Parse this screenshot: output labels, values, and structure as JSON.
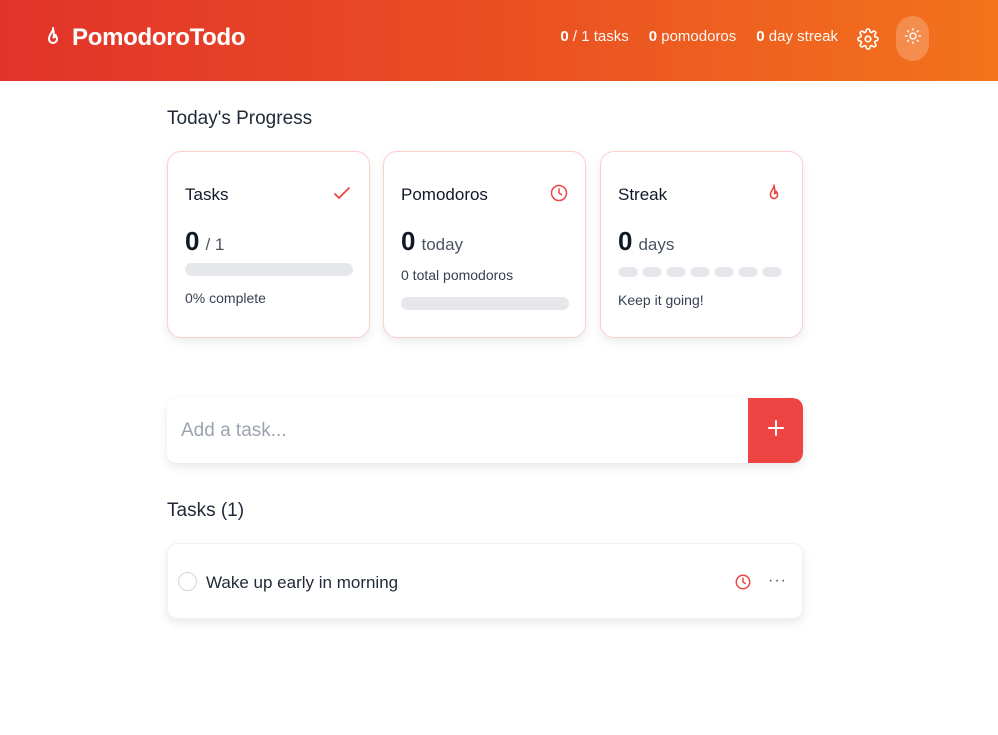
{
  "app": {
    "name": "PomodoroTodo"
  },
  "header": {
    "stats": {
      "tasks_done": "0",
      "tasks_total": "/ 1 tasks",
      "pomodoros_count": "0",
      "pomodoros_label": "pomodoros",
      "streak_count": "0",
      "streak_label": "day streak"
    },
    "settings_icon": "gear-icon",
    "theme_icon": "sun-icon"
  },
  "progress": {
    "title": "Today's Progress",
    "tasks_card": {
      "title": "Tasks",
      "icon": "check-icon",
      "value": "0",
      "value_suffix": "/ 1",
      "progress_fraction": 0,
      "note": "0% complete"
    },
    "pomodoros_card": {
      "title": "Pomodoros",
      "icon": "clock-icon",
      "value": "0",
      "value_suffix": "today",
      "note": "0 total pomodoros",
      "progress_fraction": 0
    },
    "streak_card": {
      "title": "Streak",
      "icon": "flame-icon",
      "value": "0",
      "value_suffix": "days",
      "streak_days_filled": 0,
      "streak_days_total": 7,
      "note": "Keep it going!"
    }
  },
  "add_task": {
    "placeholder": "Add a task...",
    "button_icon": "plus-icon"
  },
  "tasks": {
    "title": "Tasks (1)",
    "items": [
      {
        "text": "Wake up early in morning",
        "done": false
      }
    ],
    "more_label": "···"
  },
  "colors": {
    "accent": "#ef4444",
    "header_start": "#e2332b",
    "header_end": "#f3731c",
    "card_border": "#fbd0cc"
  }
}
